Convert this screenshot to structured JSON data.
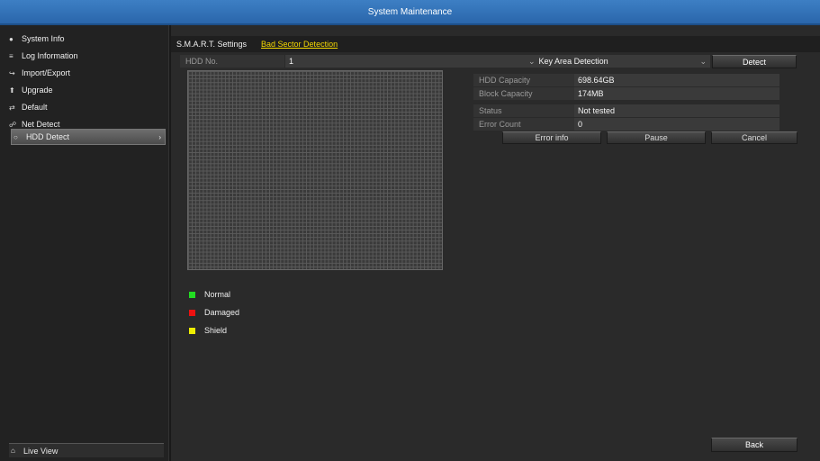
{
  "window": {
    "title": "System Maintenance"
  },
  "sidebar": {
    "items": [
      {
        "icon": "info-icon",
        "glyph": "●",
        "label": "System Info"
      },
      {
        "icon": "log-icon",
        "glyph": "≡",
        "label": "Log Information"
      },
      {
        "icon": "import-export-icon",
        "glyph": "↪",
        "label": "Import/Export"
      },
      {
        "icon": "upgrade-icon",
        "glyph": "⬆",
        "label": "Upgrade"
      },
      {
        "icon": "default-icon",
        "glyph": "⇄",
        "label": "Default"
      },
      {
        "icon": "net-detect-icon",
        "glyph": "☍",
        "label": "Net Detect"
      },
      {
        "icon": "hdd-detect-icon",
        "glyph": "○",
        "label": "HDD Detect",
        "active": true,
        "arrow": "›"
      }
    ],
    "live_view": {
      "icon": "home-icon",
      "glyph": "⌂",
      "label": "Live View"
    }
  },
  "tabs": [
    {
      "label": "S.M.A.R.T. Settings",
      "active": false
    },
    {
      "label": "Bad Sector Detection",
      "active": true
    }
  ],
  "hdd": {
    "label": "HDD No.",
    "value": "1",
    "mode": "Key Area Detection",
    "dropdown_glyph": "⌄",
    "detect_button": "Detect"
  },
  "info": {
    "hdd_capacity_label": "HDD Capacity",
    "hdd_capacity": "698.64GB",
    "block_capacity_label": "Block Capacity",
    "block_capacity": "174MB",
    "status_label": "Status",
    "status": "Not tested",
    "error_count_label": "Error Count",
    "error_count": "0"
  },
  "actions": {
    "error_info": "Error info",
    "pause": "Pause",
    "cancel": "Cancel"
  },
  "legend": [
    {
      "label": "Normal",
      "color": "#22dd22"
    },
    {
      "label": "Damaged",
      "color": "#ee1111"
    },
    {
      "label": "Shield",
      "color": "#eeee00"
    }
  ],
  "footer": {
    "back": "Back"
  }
}
